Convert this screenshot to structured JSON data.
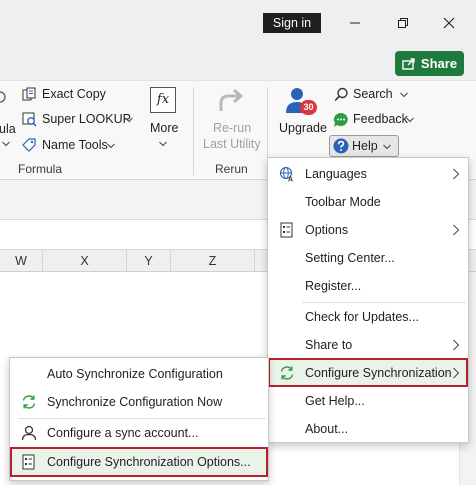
{
  "titlebar": {
    "signin_label": "Sign in"
  },
  "share": {
    "label": "Share"
  },
  "ribbon": {
    "formula_partial": "ula",
    "exact_copy": "Exact Copy",
    "super_lookup": "Super LOOKUP",
    "name_tools": "Name Tools",
    "more": "More",
    "formula_group": "Formula",
    "rerun_line1": "Re-run",
    "rerun_line2": "Last Utility",
    "rerun_group": "Rerun",
    "upgrade": "Upgrade",
    "badge_count": "30",
    "search": "Search",
    "feedback": "Feedback",
    "help": "Help",
    "fx_glyph": "fx"
  },
  "columns": [
    "W",
    "X",
    "Y",
    "Z"
  ],
  "help_menu": {
    "items": [
      {
        "label": "Languages",
        "icon": "languages-icon",
        "submenu": true
      },
      {
        "label": "Toolbar Mode",
        "icon": "",
        "submenu": true
      },
      {
        "label": "Options",
        "icon": "options-icon",
        "submenu": true
      },
      {
        "label": "Setting Center...",
        "icon": "",
        "submenu": false
      },
      {
        "label": "Register...",
        "icon": "",
        "submenu": false
      },
      {
        "label": "Check for Updates...",
        "icon": "",
        "submenu": false
      },
      {
        "label": "Share to",
        "icon": "",
        "submenu": true
      },
      {
        "label": "Configure Synchronization",
        "icon": "sync-icon",
        "submenu": true
      },
      {
        "label": "Get Help...",
        "icon": "",
        "submenu": false
      },
      {
        "label": "About...",
        "icon": "",
        "submenu": false
      }
    ]
  },
  "sync_submenu": {
    "items": [
      {
        "label": "Auto Synchronize Configuration",
        "icon": ""
      },
      {
        "label": "Synchronize Configuration Now",
        "icon": "sync-icon"
      },
      {
        "label": "Configure a sync account...",
        "icon": "user-icon"
      },
      {
        "label": "Configure Synchronization Options...",
        "icon": "options-icon"
      }
    ]
  },
  "colors": {
    "accent_green": "#1f7a3d",
    "highlight_border": "#b5222b",
    "highlight_fill": "#eaf3ea",
    "help_blue": "#2b62b8"
  }
}
